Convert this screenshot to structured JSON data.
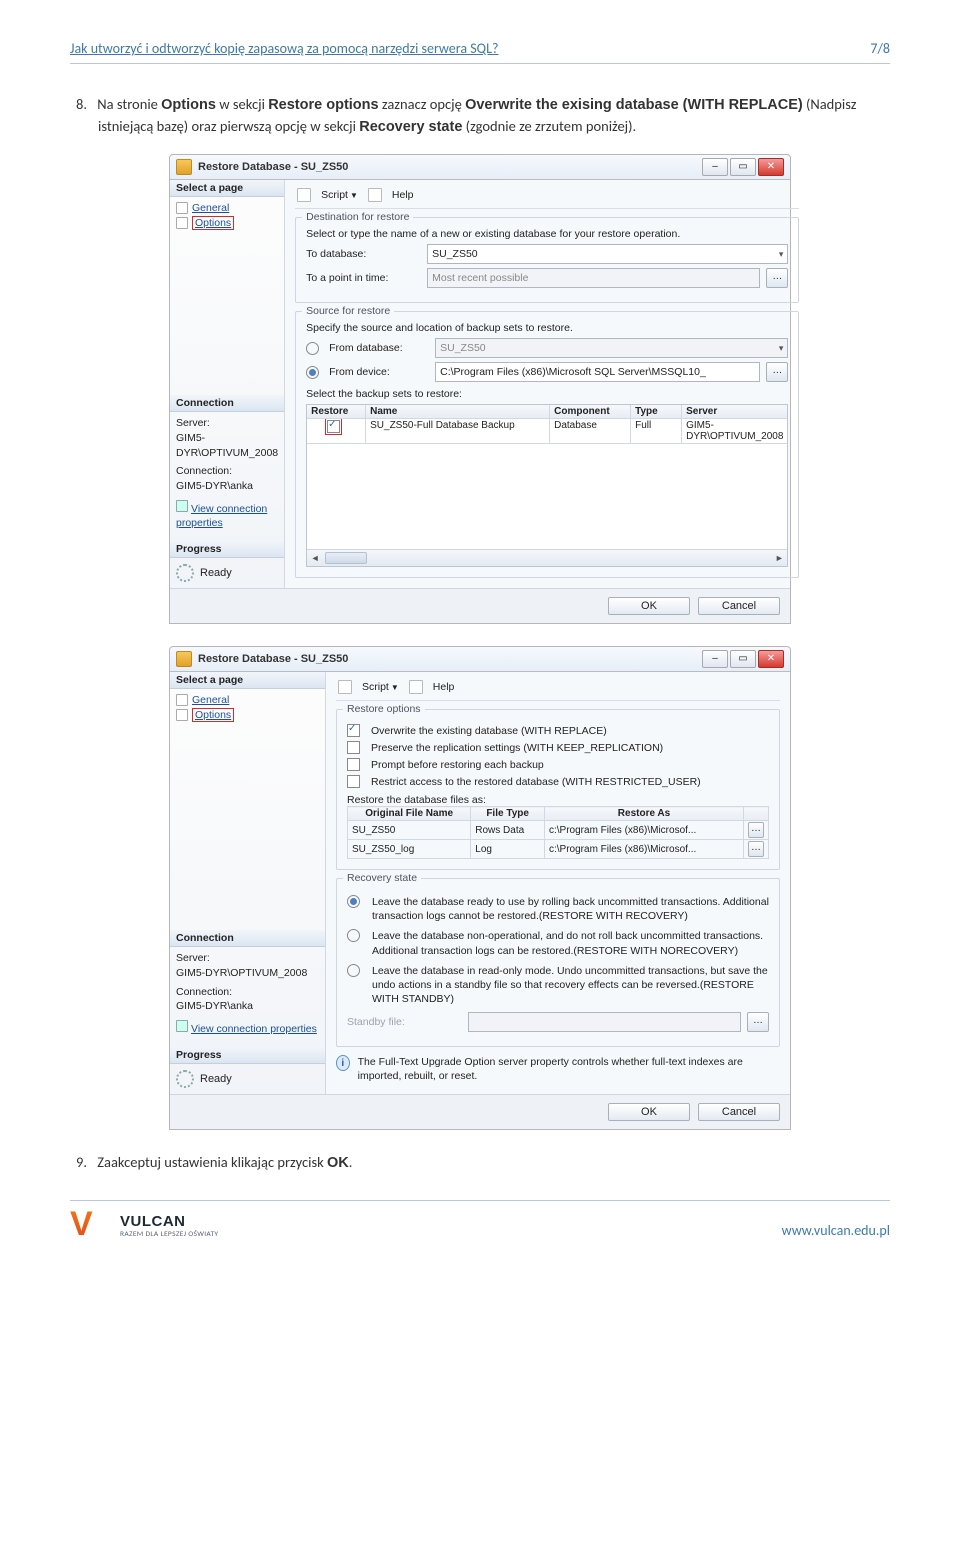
{
  "header": {
    "title": "Jak utworzyć i odtworzyć kopię zapasową za pomocą narzędzi serwera SQL?",
    "page": "7/8"
  },
  "step8": {
    "num": "8.",
    "before_opt1": "Na stronie ",
    "opt1": "Options",
    "mid1": " w sekcji ",
    "opt2": "Restore options",
    "mid2": " zaznacz opcję ",
    "opt3": "Overwrite the exising database (WITH REPLACE)",
    "mid3": " (Nadpisz istniejącą bazę) oraz pierwszą opcję w sekcji ",
    "opt4": "Recovery state",
    "after": " (zgodnie ze zrzutem poniżej)."
  },
  "step9": {
    "num": "9.",
    "text": "Zaakceptuj ustawienia klikając przycisk ",
    "btn": "OK",
    "after": "."
  },
  "sswin1": {
    "title": "Restore Database - SU_ZS50",
    "selectpage_hdr": "Select a page",
    "page_general": "General",
    "page_options": "Options",
    "conn_hdr": "Connection",
    "conn_serverlbl": "Server:",
    "conn_server": "GIM5-DYR\\OPTIVUM_2008",
    "conn_connlbl": "Connection:",
    "conn_conn": "GIM5-DYR\\anka",
    "conn_viewprops": "View connection properties",
    "prog_hdr": "Progress",
    "prog_ready": "Ready",
    "toolbar_script": "Script",
    "toolbar_help": "Help",
    "dest_legend": "Destination for restore",
    "dest_helptext": "Select or type the name of a new or existing database for your restore operation.",
    "dest_todb_lbl": "To database:",
    "dest_todb_val": "SU_ZS50",
    "dest_topit_lbl": "To a point in time:",
    "dest_topit_val": "Most recent possible",
    "src_legend": "Source for restore",
    "src_helptext": "Specify the source and location of backup sets to restore.",
    "src_fromdb_lbl": "From database:",
    "src_fromdb_val": "SU_ZS50",
    "src_fromdev_lbl": "From device:",
    "src_fromdev_val": "C:\\Program Files (x86)\\Microsoft SQL Server\\MSSQL10_",
    "src_select_lbl": "Select the backup sets to restore:",
    "grid_h": {
      "restore": "Restore",
      "name": "Name",
      "component": "Component",
      "type": "Type",
      "server": "Server"
    },
    "grid_r": {
      "name": "SU_ZS50-Full Database Backup",
      "component": "Database",
      "type": "Full",
      "server": "GIM5-DYR\\OPTIVUM_2008"
    },
    "ok": "OK",
    "cancel": "Cancel"
  },
  "sswin2": {
    "title": "Restore Database - SU_ZS50",
    "ropts_legend": "Restore options",
    "ro1": "Overwrite the existing database (WITH REPLACE)",
    "ro2": "Preserve the replication settings (WITH KEEP_REPLICATION)",
    "ro3": "Prompt before restoring each backup",
    "ro4": "Restrict access to the restored database (WITH RESTRICTED_USER)",
    "restoreas_lbl": "Restore the database files as:",
    "tbl_h": {
      "ofn": "Original File Name",
      "ft": "File Type",
      "ra": "Restore As"
    },
    "tbl_r1": {
      "ofn": "SU_ZS50",
      "ft": "Rows Data",
      "ra": "c:\\Program Files (x86)\\Microsof..."
    },
    "tbl_r2": {
      "ofn": "SU_ZS50_log",
      "ft": "Log",
      "ra": "c:\\Program Files (x86)\\Microsof..."
    },
    "rstate_legend": "Recovery state",
    "rs1": "Leave the database ready to use by rolling back uncommitted transactions. Additional transaction logs cannot be restored.(RESTORE WITH RECOVERY)",
    "rs2": "Leave the database non-operational, and do not roll back uncommitted transactions. Additional transaction logs can be restored.(RESTORE WITH NORECOVERY)",
    "rs3": "Leave the database in read-only mode. Undo uncommitted transactions, but save the undo actions in a standby file so that recovery effects can be reversed.(RESTORE WITH STANDBY)",
    "standby_lbl": "Standby file:",
    "infotext": "The Full-Text Upgrade Option server property controls whether full-text indexes are imported, rebuilt, or reset.",
    "ok": "OK",
    "cancel": "Cancel"
  },
  "footer": {
    "logo_main": "VULCAN",
    "logo_sub": "RAZEM DLA LEPSZEJ OŚWIATY",
    "url": "www.vulcan.edu.pl"
  }
}
